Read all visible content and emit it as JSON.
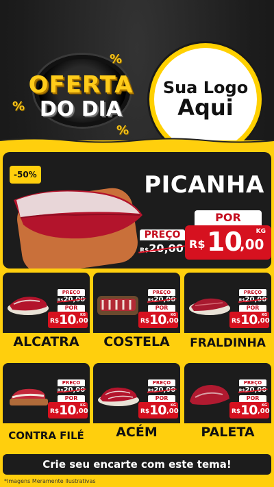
{
  "header": {
    "badge_line1": "OFERTA",
    "badge_line2": "DO DIA",
    "percent_symbol": "%",
    "logo_line1": "Sua Logo",
    "logo_line2": "Aqui"
  },
  "colors": {
    "yellow": "#ffcf0d",
    "red": "#d6111f",
    "dark": "#1c1c1c"
  },
  "hero": {
    "discount": "-50%",
    "name": "PICANHA",
    "preco_label": "PREÇO",
    "old_price_currency": "R$",
    "old_price": "20,00",
    "por_label": "POR",
    "currency": "R$",
    "price_int": "10",
    "price_dec": ",00",
    "unit": "KG"
  },
  "products": [
    {
      "name": "ALCATRA",
      "preco_label": "PREÇO",
      "old_currency": "R$",
      "old_price": "20,00",
      "por_label": "POR",
      "currency": "R$",
      "price_int": "10",
      "price_dec": ",00",
      "unit": "KG"
    },
    {
      "name": "COSTELA",
      "preco_label": "PREÇO",
      "old_currency": "R$",
      "old_price": "20,00",
      "por_label": "POR",
      "currency": "R$",
      "price_int": "10",
      "price_dec": ",00",
      "unit": "KG"
    },
    {
      "name": "FRALDINHA",
      "preco_label": "PREÇO",
      "old_currency": "R$",
      "old_price": "20,00",
      "por_label": "POR",
      "currency": "R$",
      "price_int": "10",
      "price_dec": ",00",
      "unit": "KG"
    },
    {
      "name": "CONTRA FILÉ",
      "preco_label": "PREÇO",
      "old_currency": "R$",
      "old_price": "20,00",
      "por_label": "POR",
      "currency": "R$",
      "price_int": "10",
      "price_dec": ",00",
      "unit": "KG"
    },
    {
      "name": "ACÉM",
      "preco_label": "PREÇO",
      "old_currency": "R$",
      "old_price": "20,00",
      "por_label": "POR",
      "currency": "R$",
      "price_int": "10",
      "price_dec": ",00",
      "unit": "KG"
    },
    {
      "name": "PALETA",
      "preco_label": "PREÇO",
      "old_currency": "R$",
      "old_price": "20,00",
      "por_label": "POR",
      "currency": "R$",
      "price_int": "10",
      "price_dec": ",00",
      "unit": "KG"
    }
  ],
  "footer": {
    "cta": "Crie seu encarte com este tema!",
    "note": "*Imagens Meramente Ilustrativas"
  }
}
